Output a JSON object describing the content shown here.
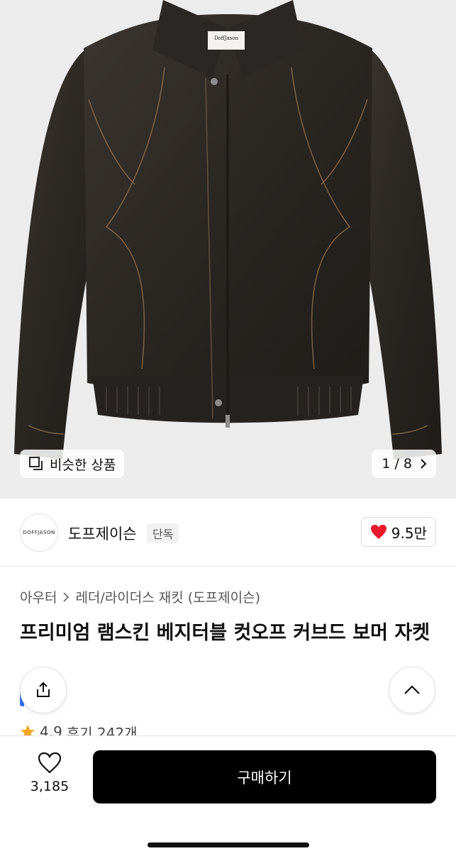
{
  "gallery": {
    "similar_label": "비슷한 상품",
    "pager": "1 / 8",
    "jacket_tag_text": "DoffJason"
  },
  "brand": {
    "logo_text": "DOFFJASON",
    "name": "도프제이슨",
    "badge": "단독",
    "likes": "9.5만"
  },
  "breadcrumb": {
    "category": "아우터",
    "subcategory": "레더/라이더스 재킷 (도프제이슨)"
  },
  "product": {
    "title": "프리미엄 램스킨 베지터블 컷오프 커브드 보머 자켓"
  },
  "rating": {
    "score": "4.9",
    "reviews": "후기 242개"
  },
  "bottom_bar": {
    "wish_count": "3,185",
    "buy_label": "구매하기"
  },
  "colors": {
    "accent_red": "#e8192c",
    "button_black": "#000000",
    "star": "#f5a623"
  }
}
